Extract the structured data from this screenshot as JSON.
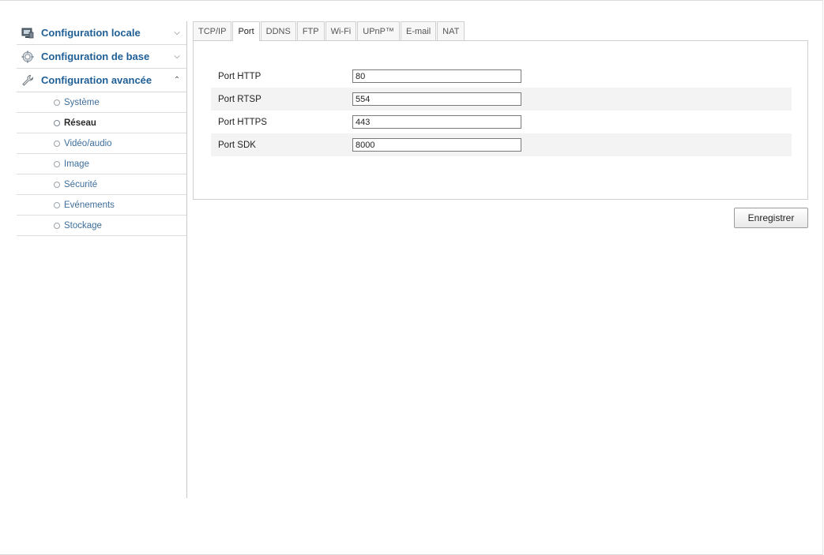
{
  "sidebar": {
    "sections": [
      {
        "label": "Configuration locale",
        "icon": "monitor-icon",
        "expanded": false
      },
      {
        "label": "Configuration de base",
        "icon": "gear-icon",
        "expanded": false
      },
      {
        "label": "Configuration avancée",
        "icon": "wrench-icon",
        "expanded": true
      }
    ],
    "items": [
      {
        "label": "Système",
        "active": false
      },
      {
        "label": "Réseau",
        "active": true
      },
      {
        "label": "Vidéo/audio",
        "active": false
      },
      {
        "label": "Image",
        "active": false
      },
      {
        "label": "Sécurité",
        "active": false
      },
      {
        "label": "Evénements",
        "active": false
      },
      {
        "label": "Stockage",
        "active": false
      }
    ]
  },
  "tabs": [
    {
      "label": "TCP/IP",
      "active": false
    },
    {
      "label": "Port",
      "active": true
    },
    {
      "label": "DDNS",
      "active": false
    },
    {
      "label": "FTP",
      "active": false
    },
    {
      "label": "Wi-Fi",
      "active": false
    },
    {
      "label": "UPnP™",
      "active": false
    },
    {
      "label": "E-mail",
      "active": false
    },
    {
      "label": "NAT",
      "active": false
    }
  ],
  "form": {
    "rows": [
      {
        "label": "Port HTTP",
        "value": "80"
      },
      {
        "label": "Port RTSP",
        "value": "554"
      },
      {
        "label": "Port HTTPS",
        "value": "443"
      },
      {
        "label": "Port SDK",
        "value": "8000"
      }
    ]
  },
  "actions": {
    "save_label": "Enregistrer"
  },
  "colors": {
    "section_label": "#1f5f96",
    "item_label": "#3e6e9a",
    "row_alt_bg": "#f3f3f3",
    "border": "#cfcfcf"
  }
}
